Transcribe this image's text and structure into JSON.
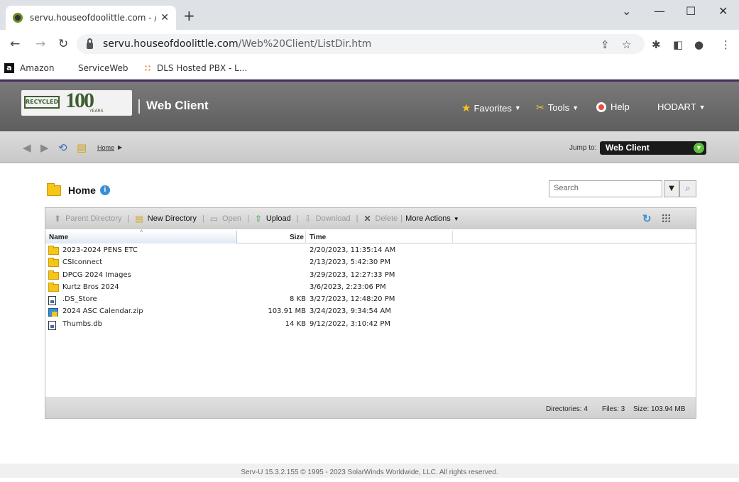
{
  "browser": {
    "tab_title": "servu.houseofdoolittle.com - /",
    "url_host": "servu.houseofdoolittle.com",
    "url_path": "/Web%20Client/ListDir.htm",
    "bookmarks": [
      "Amazon",
      "ServiceWeb",
      "DLS Hosted PBX - L..."
    ]
  },
  "app": {
    "logo_text": "RECYCLED",
    "logo_number": "100",
    "logo_years": "YEARS",
    "title": "Web Client",
    "menu": {
      "favorites": "Favorites",
      "tools": "Tools",
      "help": "Help",
      "user": "HODART"
    }
  },
  "nav": {
    "breadcrumb": "Home",
    "jump_label": "Jump to:",
    "jump_value": "Web Client"
  },
  "content": {
    "heading": "Home",
    "search_placeholder": "Search",
    "toolbar": {
      "parent_directory": "Parent Directory",
      "new_directory": "New Directory",
      "open": "Open",
      "upload": "Upload",
      "download": "Download",
      "delete": "Delete",
      "more_actions": "More Actions"
    },
    "columns": {
      "name": "Name",
      "size": "Size",
      "time": "Time"
    },
    "files": [
      {
        "name": "2023-2024 PENS ETC",
        "size": "",
        "time": "2/20/2023, 11:35:14 AM",
        "type": "folder-icon"
      },
      {
        "name": "CSIconnect",
        "size": "",
        "time": "2/13/2023, 5:42:30 PM",
        "type": "folder-icon"
      },
      {
        "name": "DPCG 2024 Images",
        "size": "",
        "time": "3/29/2023, 12:27:33 PM",
        "type": "folder-icon"
      },
      {
        "name": "Kurtz Bros 2024",
        "size": "",
        "time": "3/6/2023, 2:23:06 PM",
        "type": "folder-icon"
      },
      {
        "name": ".DS_Store",
        "size": "8 KB",
        "time": "3/27/2023, 12:48:20 PM",
        "type": "file-icon"
      },
      {
        "name": "2024 ASC Calendar.zip",
        "size": "103.91 MB",
        "time": "3/24/2023, 9:34:54 AM",
        "type": "zip-icon"
      },
      {
        "name": "Thumbs.db",
        "size": "14 KB",
        "time": "9/12/2022, 3:10:42 PM",
        "type": "file-icon"
      }
    ],
    "status": {
      "directories": "Directories: 4",
      "files": "Files: 3",
      "size": "Size: 103.94 MB"
    }
  },
  "footer": "Serv-U 15.3.2.155 © 1995 - 2023 SolarWinds Worldwide, LLC. All rights reserved."
}
